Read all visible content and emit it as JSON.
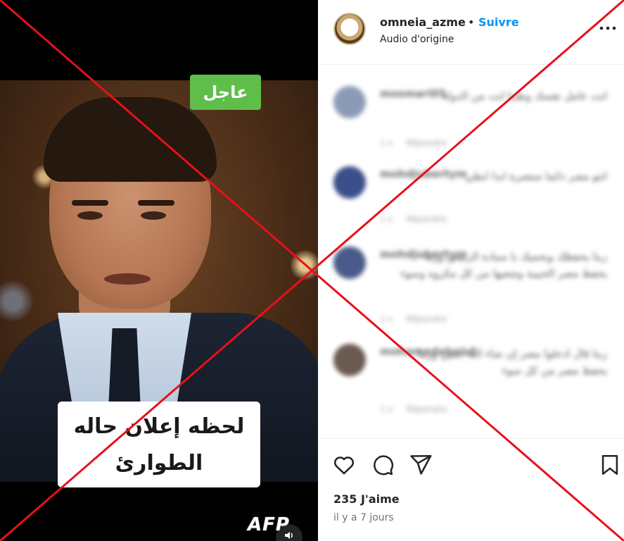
{
  "video": {
    "badge_text": "عاجل",
    "caption_line1": "لحظه إعلان حاله",
    "caption_line2": "الطوارئ"
  },
  "post": {
    "username": "omneia_azme",
    "separator": "•",
    "follow_label": "Suivre",
    "audio_label": "Audio d'origine",
    "likes": "235 J'aime",
    "time_ago": "il y a 7 jours"
  },
  "comments": [
    {
      "user": "mosmari05",
      "text": "انت عامل نفسك وطنيا انت من الدولة",
      "meta": [
        "1 s",
        "Répondre"
      ],
      "avatar_color": "#8c9bb5"
    },
    {
      "user": "mohdjubertym",
      "text": "انتو مصر دائما منتصرة ابدا ابطي",
      "meta": [
        "1 s",
        "Répondre"
      ],
      "avatar_color": "#3b4f8a"
    },
    {
      "user": "mohdjubertym",
      "text": "ربنا يحفظك ويحميك يا سيادة الرئيس وربنا يحفظ مصر الحبيبة وشعبها من كل مكروه وسوء",
      "meta": [
        "1 s",
        "Répondre"
      ],
      "avatar_color": "#4a5a8a"
    },
    {
      "user": "mohamedaboud",
      "text": "ربنا قال ادخلوا مصر إن شاء الله آمنين وربنا يحفظ مصر من كل سوء",
      "meta": [
        "1 s",
        "Répondre"
      ],
      "avatar_color": "#6b5a4f"
    }
  ],
  "watermark": "AFP",
  "colors": {
    "follow": "#0095f6",
    "cross": "#e8101a",
    "badge": "#5fbe4a"
  },
  "icons": [
    "heart-icon",
    "comment-icon",
    "share-icon",
    "bookmark-icon",
    "more-icon",
    "volume-icon"
  ]
}
